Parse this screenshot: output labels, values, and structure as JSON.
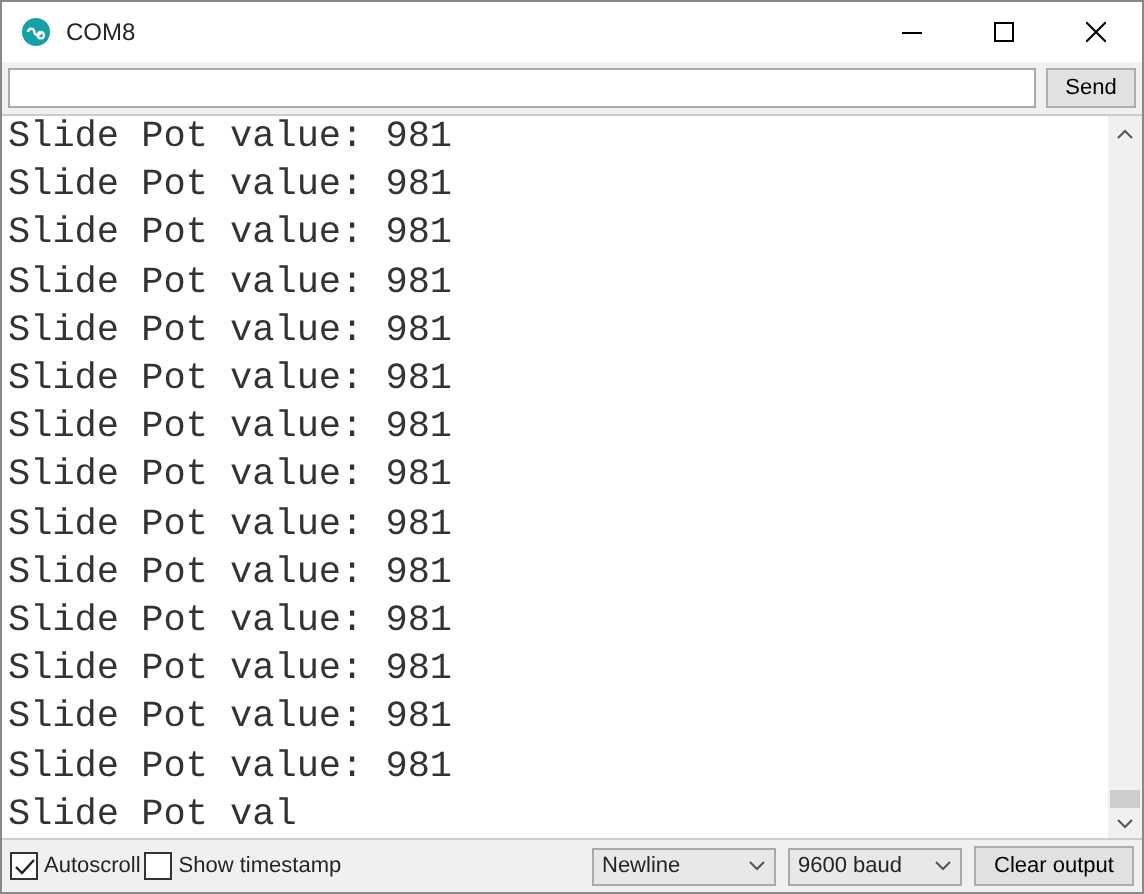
{
  "window": {
    "title": "COM8"
  },
  "send_button": "Send",
  "output_lines": [
    "Slide Pot value: 981",
    "Slide Pot value: 981",
    "Slide Pot value: 981",
    "Slide Pot value: 981",
    "Slide Pot value: 981",
    "Slide Pot value: 981",
    "Slide Pot value: 981",
    "Slide Pot value: 981",
    "Slide Pot value: 981",
    "Slide Pot value: 981",
    "Slide Pot value: 981",
    "Slide Pot value: 981",
    "Slide Pot value: 981",
    "Slide Pot value: 981",
    "Slide Pot val"
  ],
  "options": [
    {
      "label": "Autoscroll",
      "checked": true
    },
    {
      "label": "Show timestamp",
      "checked": false
    }
  ],
  "line_ending": "Newline",
  "baud_rate": "9600 baud",
  "clear_button": "Clear output"
}
